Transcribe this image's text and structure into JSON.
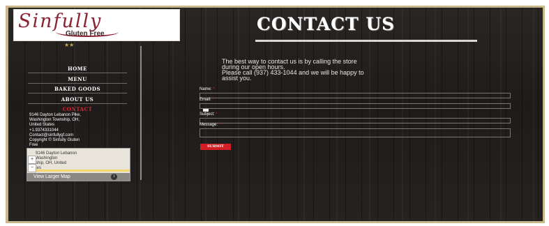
{
  "brand": {
    "script": "Sinfully",
    "sub": "Gluten Free",
    "accent": "#8c2233"
  },
  "page_title": "CONTACT US",
  "stars": "★★",
  "nav": [
    {
      "label": "HOME"
    },
    {
      "label": "MENU"
    },
    {
      "label": "BAKED GOODS"
    },
    {
      "label": "ABOUT US"
    },
    {
      "label": "CONTACT",
      "active": true
    }
  ],
  "info": {
    "address": [
      "9146 Dayton Lebanon Pike,",
      "Washington Township, OH,",
      "United States"
    ],
    "phone": "+1.9374331044",
    "email": "Contact@sinfullygf.com",
    "copyright": [
      "Copyright © Sinfully Gluten",
      "Free"
    ]
  },
  "map": {
    "lines": [
      "9146 Dayton Lebanon",
      "Washington",
      "ship, OH, United",
      "tes"
    ],
    "zoom_in": "+",
    "zoom_out": "−",
    "link": "View Larger Map",
    "info_icon": "i"
  },
  "intro": [
    "The best way to contact us is by calling the store",
    "during our open hours.",
    "Please call (937) 433-1044 and we will be happy to",
    "assist you."
  ],
  "form": {
    "name_label": "Name:",
    "email_label": "Email:",
    "subject_label": "Subject:",
    "message_label": "Message:",
    "required_mark": "*",
    "submit_label": "SUBMIT",
    "submit_color": "#d21f26"
  }
}
